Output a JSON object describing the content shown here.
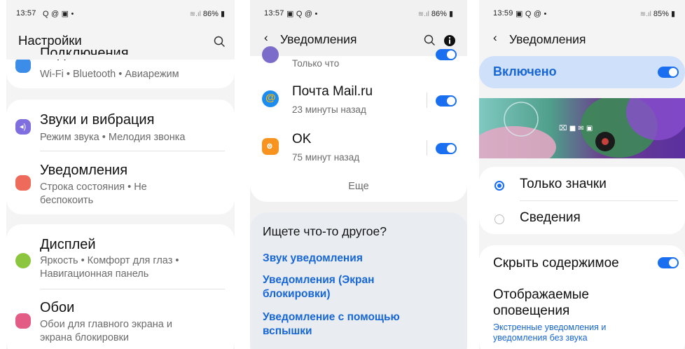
{
  "colors": {
    "accent": "#1a6ff0",
    "link": "#1766d6",
    "enabled_banner": "#cfe0fa"
  },
  "panel1": {
    "status": {
      "time": "13:57",
      "battery": "86%"
    },
    "title": "Настройки",
    "cut_item": {
      "title": "Подключения",
      "sub": "Wi-Fi • Bluetooth • Авиарежим"
    },
    "sounds": {
      "title": "Звуки и вибрация",
      "sub": "Режим звука • Мелодия звонка"
    },
    "notifications": {
      "title": "Уведомления",
      "sub1": "Строка состояния • Не",
      "sub2": "беспокоить"
    },
    "display": {
      "title": "Дисплей",
      "sub1": "Яркость • Комфорт для глаз •",
      "sub2": "Навигационная панель"
    },
    "wallpaper": {
      "title": "Обои",
      "sub1": "Обои для главного экрана и",
      "sub2": "экрана блокировки"
    }
  },
  "panel2": {
    "status": {
      "time": "13:57",
      "battery": "86%"
    },
    "title": "Уведомления",
    "top_item_time": "Только что",
    "apps": [
      {
        "name": "Почта Mail.ru",
        "time": "23 минуты назад"
      },
      {
        "name": "OK",
        "time": "75 минут назад"
      }
    ],
    "more": "Еще",
    "search_heading": "Ищете что-то другое?",
    "links": {
      "l1": "Звук уведомления",
      "l2a": "Уведомления (Экран",
      "l2b": "блокировки)",
      "l3a": "Уведомление с помощью",
      "l3b": "вспышки"
    }
  },
  "panel3": {
    "status": {
      "time": "13:59",
      "battery": "85%"
    },
    "title": "Уведомления",
    "enabled_label": "Включено",
    "option_icons": "Только значки",
    "option_details": "Сведения",
    "hide_content": "Скрыть содержимое",
    "shown_alerts_a": "Отображаемые",
    "shown_alerts_b": "оповещения",
    "shown_sub_a": "Экстренные уведомления и",
    "shown_sub_b": "уведомления без звука"
  }
}
